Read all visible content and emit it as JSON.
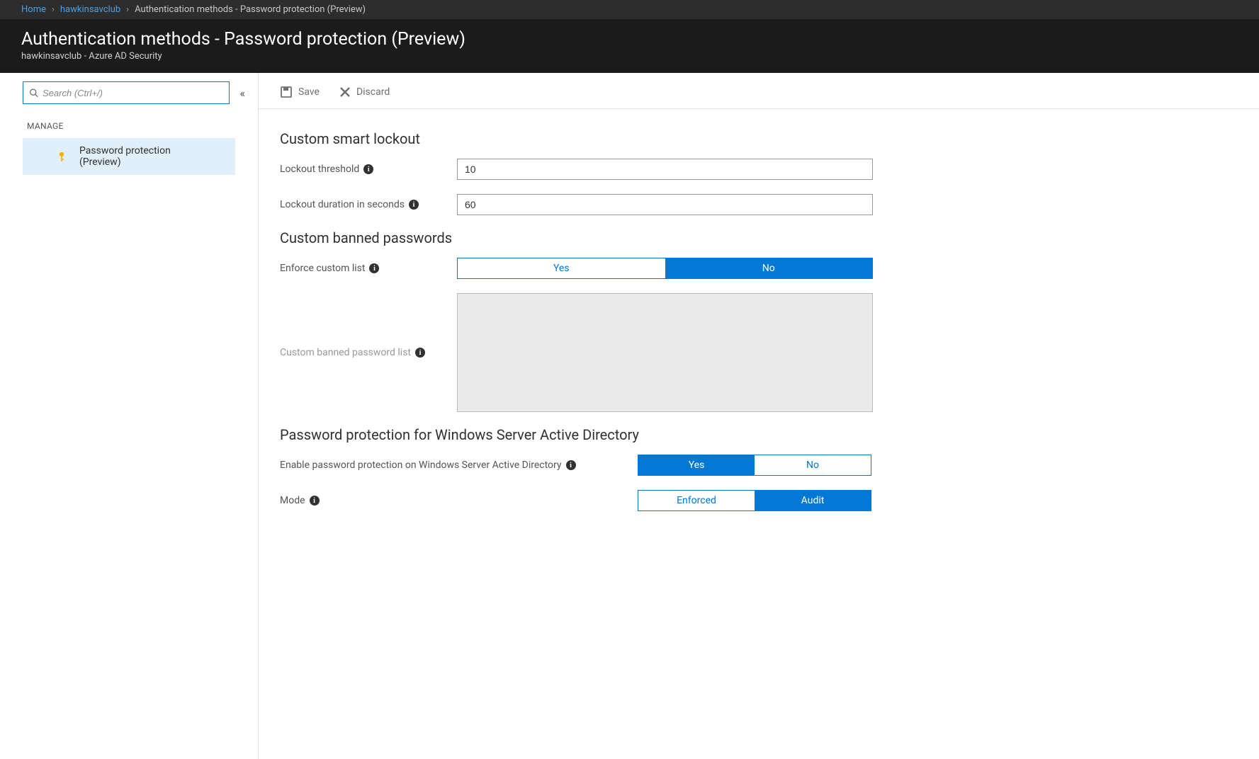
{
  "breadcrumb": {
    "home": "Home",
    "org": "hawkinsavclub",
    "current": "Authentication methods - Password protection (Preview)"
  },
  "header": {
    "title": "Authentication methods - Password protection (Preview)",
    "subtitle": "hawkinsavclub - Azure AD Security"
  },
  "sidebar": {
    "search_placeholder": "Search (Ctrl+/)",
    "section_label": "MANAGE",
    "item_label": "Password protection (Preview)"
  },
  "toolbar": {
    "save": "Save",
    "discard": "Discard"
  },
  "sections": {
    "smart_lockout": {
      "title": "Custom smart lockout",
      "threshold_label": "Lockout threshold",
      "threshold_value": "10",
      "duration_label": "Lockout duration in seconds",
      "duration_value": "60"
    },
    "banned": {
      "title": "Custom banned passwords",
      "enforce_label": "Enforce custom list",
      "enforce_yes": "Yes",
      "enforce_no": "No",
      "list_label": "Custom banned password list"
    },
    "winserver": {
      "title": "Password protection for Windows Server Active Directory",
      "enable_label": "Enable password protection on Windows Server Active Directory",
      "enable_yes": "Yes",
      "enable_no": "No",
      "mode_label": "Mode",
      "mode_enforced": "Enforced",
      "mode_audit": "Audit"
    }
  }
}
